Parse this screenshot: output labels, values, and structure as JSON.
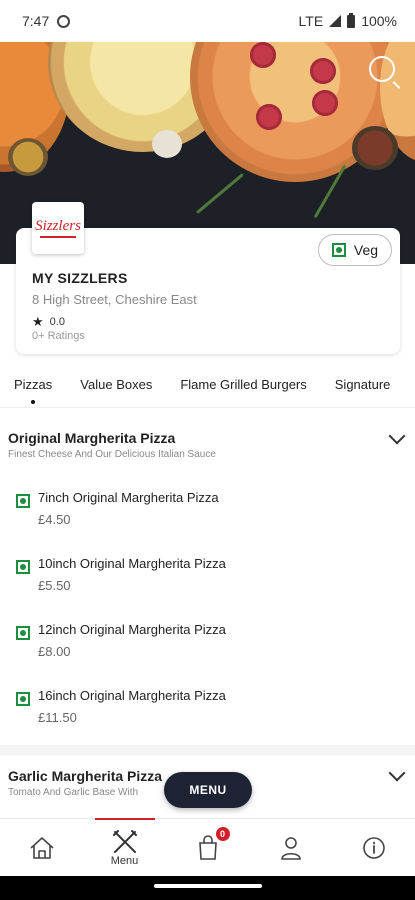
{
  "status_bar": {
    "time": "7:47",
    "network": "LTE",
    "battery": "100%"
  },
  "restaurant": {
    "logo_text": "Sizzlers",
    "name": "MY SIZZLERS",
    "address": "8 High Street, Cheshire East",
    "rating": "0.0",
    "rating_count": "0+ Ratings",
    "veg_label": "Veg"
  },
  "tabs": [
    "Pizzas",
    "Value Boxes",
    "Flame Grilled Burgers",
    "Signature"
  ],
  "sections": [
    {
      "title": "Original Margherita  Pizza",
      "subtitle": "Finest Cheese And Our Delicious Italian Sauce",
      "items": [
        {
          "name": "7inch Original Margherita  Pizza",
          "price": "£4.50"
        },
        {
          "name": "10inch Original Margherita  Pizza",
          "price": "£5.50"
        },
        {
          "name": "12inch Original Margherita  Pizza",
          "price": "£8.00"
        },
        {
          "name": "16inch Original Margherita  Pizza",
          "price": "£11.50"
        }
      ]
    },
    {
      "title": "Garlic Margherita  Pizza",
      "subtitle": "Tomato And Garlic Base With"
    }
  ],
  "fab": {
    "label": "MENU"
  },
  "bottom_nav": {
    "menu_label": "Menu",
    "cart_count": "0"
  },
  "colors": {
    "accent": "#d21f2a",
    "veg": "#1e8e3e",
    "fab": "#1e2333"
  }
}
